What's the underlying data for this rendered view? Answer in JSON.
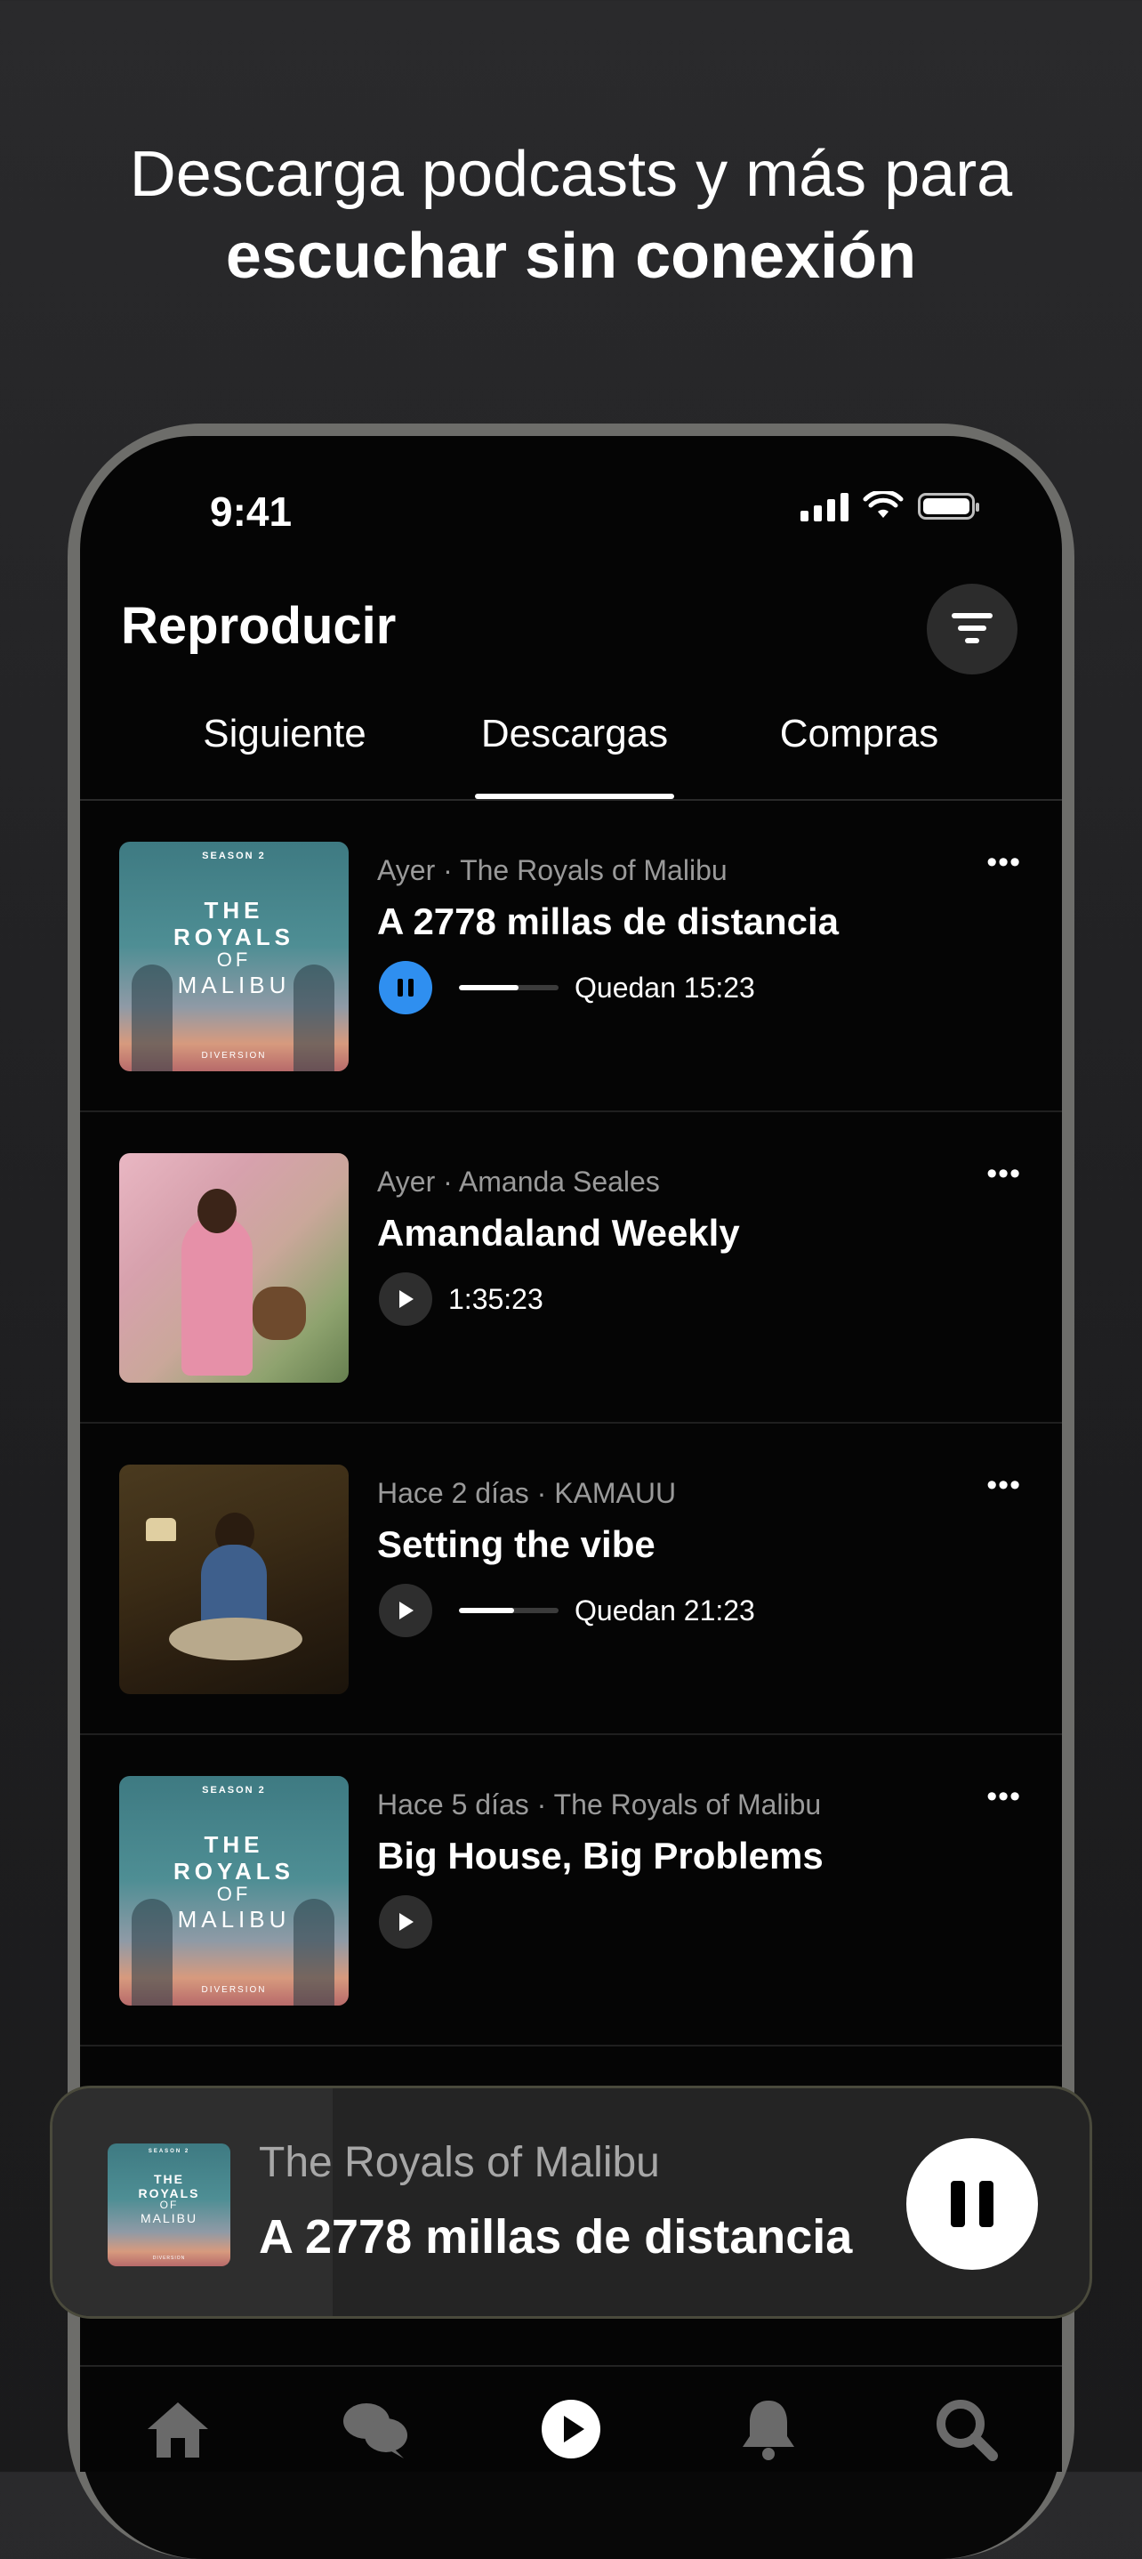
{
  "headline": {
    "line1": "Descarga podcasts y más para",
    "line2": "escuchar sin conexión"
  },
  "status_bar": {
    "time": "9:41"
  },
  "header": {
    "title": "Reproducir"
  },
  "tabs": [
    {
      "label": "Siguiente",
      "active": false
    },
    {
      "label": "Descargas",
      "active": true
    },
    {
      "label": "Compras",
      "active": false
    }
  ],
  "episodes": [
    {
      "meta": "Ayer · The Royals of Malibu",
      "title": "A 2778 millas de distancia",
      "state": "playing",
      "progress_fraction": 0.6,
      "time_text": "Quedan 15:23",
      "cover": "royals"
    },
    {
      "meta": "Ayer · Amanda Seales",
      "title": "Amandaland Weekly",
      "state": "paused",
      "time_text": "1:35:23",
      "cover": "amanda"
    },
    {
      "meta": "Hace 2 días · KAMAUU",
      "title": "Setting the vibe",
      "state": "paused",
      "progress_fraction": 0.55,
      "time_text": "Quedan 21:23",
      "cover": "kamauu"
    },
    {
      "meta": "Hace 5 días · The Royals of Malibu",
      "title": "Big House, Big Problems",
      "state": "paused",
      "time_text": "",
      "cover": "royals"
    }
  ],
  "cover_art": {
    "royals": {
      "season": "SEASON 2",
      "line1": "THE",
      "line2": "ROYALS",
      "line3": "OF",
      "line4": "MALIBU",
      "brand": "DIVERSION"
    }
  },
  "more_glyph": "•••",
  "mini_player": {
    "show": "The Royals of Malibu",
    "episode": "A 2778 millas de distancia",
    "progress_fraction": 0.27
  },
  "bottom_nav": [
    "home-icon",
    "chat-icon",
    "play-icon",
    "bell-icon",
    "search-icon"
  ],
  "colors": {
    "accent_blue": "#2f8ff0",
    "background": "#050505"
  }
}
